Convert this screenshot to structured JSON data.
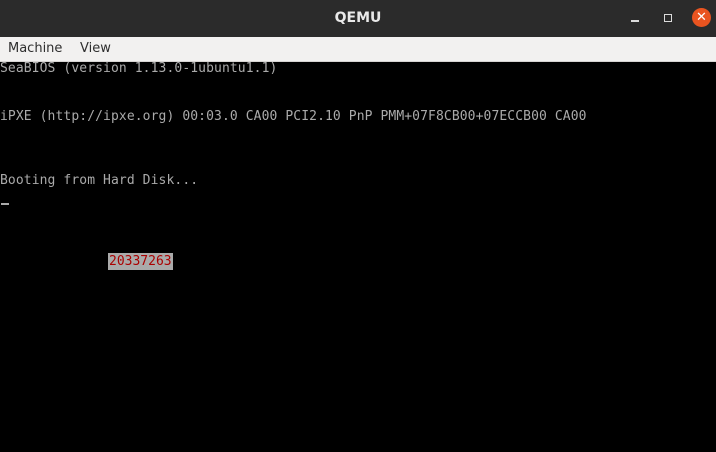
{
  "window": {
    "title": "QEMU",
    "close_symbol": "✕",
    "accent_close_color": "#e95420"
  },
  "menubar": {
    "items": [
      {
        "label": "Machine"
      },
      {
        "label": "View"
      }
    ]
  },
  "console": {
    "lines": [
      "SeaBIOS (version 1.13.0-1ubuntu1.1)",
      "iPXE (http://ipxe.org) 00:03.0 CA00 PCI2.10 PnP PMM+07F8CB00+07ECCB00 CA00",
      "Booting from Hard Disk..."
    ],
    "highlighted_value": "20337263",
    "text_color": "#aaaaaa",
    "highlight_bg": "#aaaaaa",
    "highlight_fg": "#aa0000"
  }
}
